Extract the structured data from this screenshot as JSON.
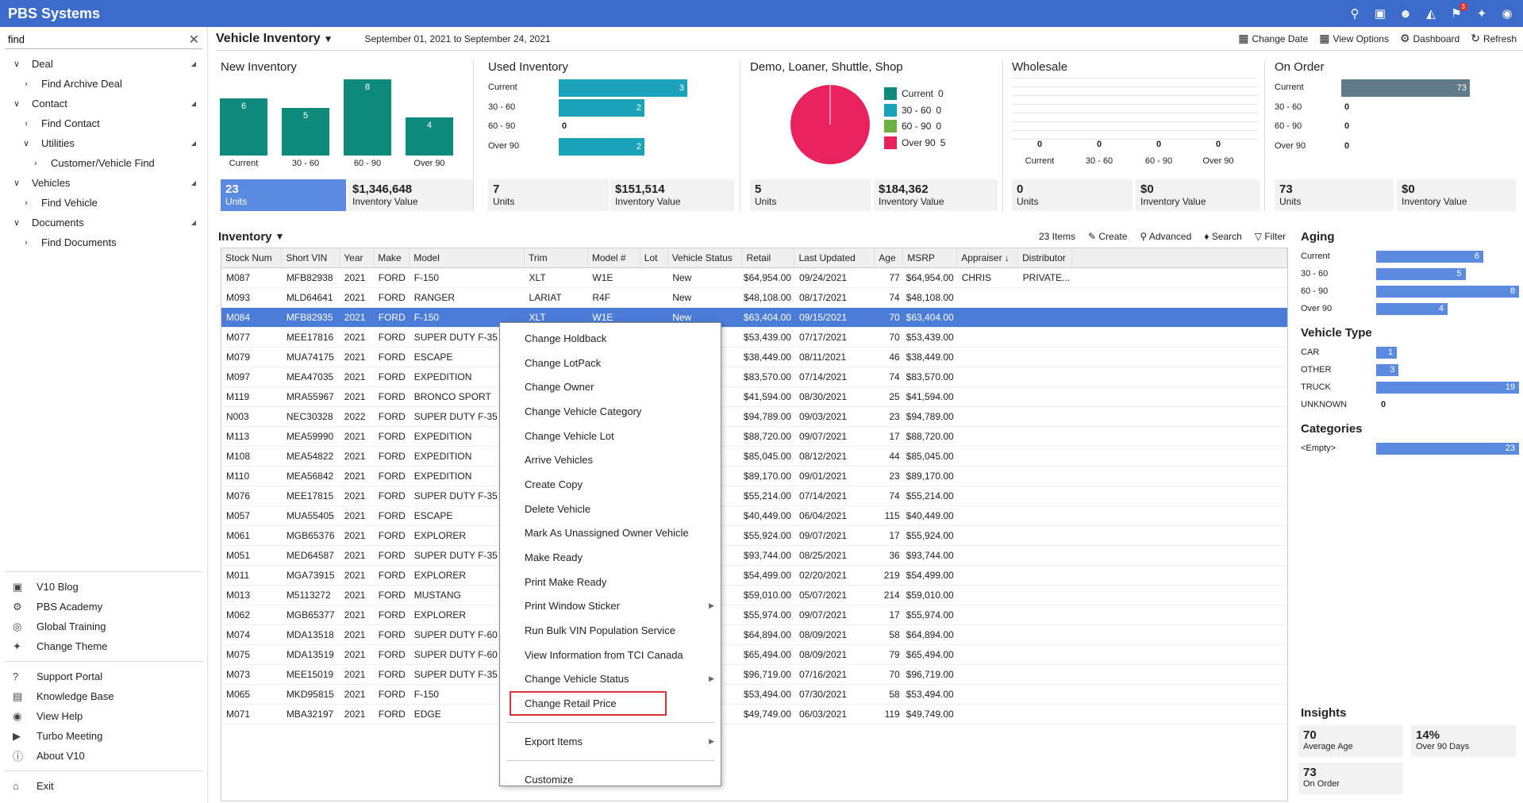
{
  "app": {
    "title": "PBS Systems"
  },
  "topbar": {
    "icons": [
      "search-icon",
      "chat-icon",
      "users-icon",
      "inbox-icon",
      "flag-icon",
      "pin-icon",
      "eye-icon"
    ],
    "flag_badge": "3"
  },
  "sidebar": {
    "search_value": "find",
    "tree": [
      {
        "label": "Deal",
        "level": 0,
        "expanded": true
      },
      {
        "label": "Find Archive Deal",
        "level": 1,
        "expanded": false
      },
      {
        "label": "Contact",
        "level": 0,
        "expanded": true
      },
      {
        "label": "Find Contact",
        "level": 1,
        "expanded": false
      },
      {
        "label": "Utilities",
        "level": 1,
        "expanded": true
      },
      {
        "label": "Customer/Vehicle Find",
        "level": 2,
        "expanded": false
      },
      {
        "label": "Vehicles",
        "level": 0,
        "expanded": true
      },
      {
        "label": "Find Vehicle",
        "level": 1,
        "expanded": false
      },
      {
        "label": "Documents",
        "level": 0,
        "expanded": true
      },
      {
        "label": "Find Documents",
        "level": 1,
        "expanded": false
      }
    ],
    "links_a": [
      {
        "label": "V10 Blog",
        "icon": "blog-icon"
      },
      {
        "label": "PBS Academy",
        "icon": "academy-icon"
      },
      {
        "label": "Global Training",
        "icon": "globe-icon"
      },
      {
        "label": "Change Theme",
        "icon": "theme-icon"
      }
    ],
    "links_b": [
      {
        "label": "Support Portal",
        "icon": "help-icon"
      },
      {
        "label": "Knowledge Base",
        "icon": "book-icon"
      },
      {
        "label": "View Help",
        "icon": "eye-icon"
      },
      {
        "label": "Turbo Meeting",
        "icon": "video-icon"
      },
      {
        "label": "About V10",
        "icon": "info-icon"
      }
    ],
    "exit": "Exit"
  },
  "header": {
    "title": "Vehicle Inventory",
    "date_range": "September 01, 2021 to September 24, 2021",
    "actions": {
      "change_date": "Change Date",
      "view_options": "View Options",
      "dashboard": "Dashboard",
      "refresh": "Refresh"
    }
  },
  "cards": {
    "new": {
      "title": "New Inventory",
      "categories": [
        "Current",
        "30 - 60",
        "60 - 90",
        "Over 90"
      ],
      "values": [
        6,
        5,
        8,
        4
      ],
      "units": "23",
      "units_label": "Units",
      "value": "$1,346,648",
      "value_label": "Inventory Value"
    },
    "used": {
      "title": "Used Inventory",
      "categories": [
        "Current",
        "30 - 60",
        "60 - 90",
        "Over 90"
      ],
      "values": [
        3,
        2,
        0,
        2
      ],
      "units": "7",
      "units_label": "Units",
      "value": "$151,514",
      "value_label": "Inventory Value"
    },
    "demo": {
      "title": "Demo, Loaner, Shuttle, Shop",
      "legend": [
        {
          "label": "Current",
          "value": "0",
          "color": "#0d8a7a"
        },
        {
          "label": "30 - 60",
          "value": "0",
          "color": "#1aa3b8"
        },
        {
          "label": "60 - 90",
          "value": "0",
          "color": "#6fb043"
        },
        {
          "label": "Over 90",
          "value": "5",
          "color": "#e8215f"
        }
      ],
      "units": "5",
      "units_label": "Units",
      "value": "$184,362",
      "value_label": "Inventory Value"
    },
    "wholesale": {
      "title": "Wholesale",
      "categories": [
        "Current",
        "30 - 60",
        "60 - 90",
        "Over 90"
      ],
      "values": [
        "0",
        "0",
        "0",
        "0"
      ],
      "units": "0",
      "units_label": "Units",
      "value": "$0",
      "value_label": "Inventory Value"
    },
    "onorder": {
      "title": "On Order",
      "categories": [
        "Current",
        "30 - 60",
        "60 - 90",
        "Over 90"
      ],
      "values": [
        73,
        0,
        0,
        0
      ],
      "units": "73",
      "units_label": "Units",
      "value": "$0",
      "value_label": "Inventory Value"
    }
  },
  "inventory": {
    "title": "Inventory",
    "item_count": "23 Items",
    "tools": {
      "create": "Create",
      "advanced": "Advanced",
      "search": "Search",
      "filter": "Filter"
    },
    "columns": [
      "Stock Num",
      "Short VIN",
      "Year",
      "Make",
      "Model",
      "Trim",
      "Model #",
      "Lot",
      "Vehicle Status",
      "Retail",
      "Last Updated",
      "Age",
      "MSRP",
      "Appraiser",
      "Distributor"
    ],
    "rows": [
      [
        "M087",
        "MFB82938",
        "2021",
        "FORD",
        "F-150",
        "XLT",
        "W1E",
        "",
        "New",
        "$64,954.00",
        "09/24/2021",
        "77",
        "$64,954.00",
        "CHRIS",
        "PRIVATE..."
      ],
      [
        "M093",
        "MLD64641",
        "2021",
        "FORD",
        "RANGER",
        "LARIAT",
        "R4F",
        "",
        "New",
        "$48,108.00",
        "08/17/2021",
        "74",
        "$48,108.00",
        "",
        ""
      ],
      [
        "M084",
        "MFB82935",
        "2021",
        "FORD",
        "F-150",
        "XLT",
        "W1E",
        "",
        "New",
        "$63,404.00",
        "09/15/2021",
        "70",
        "$63,404.00",
        "",
        ""
      ],
      [
        "M077",
        "MEE17816",
        "2021",
        "FORD",
        "SUPER DUTY F-35",
        "",
        "",
        "",
        "",
        "$53,439.00",
        "07/17/2021",
        "70",
        "$53,439.00",
        "",
        ""
      ],
      [
        "M079",
        "MUA74175",
        "2021",
        "FORD",
        "ESCAPE",
        "",
        "",
        "",
        "",
        "$38,449.00",
        "08/11/2021",
        "46",
        "$38,449.00",
        "",
        ""
      ],
      [
        "M097",
        "MEA47035",
        "2021",
        "FORD",
        "EXPEDITION",
        "",
        "",
        "",
        "",
        "$83,570.00",
        "07/14/2021",
        "74",
        "$83,570.00",
        "",
        ""
      ],
      [
        "M119",
        "MRA55967",
        "2021",
        "FORD",
        "BRONCO SPORT",
        "",
        "",
        "",
        "",
        "$41,594.00",
        "08/30/2021",
        "25",
        "$41,594.00",
        "",
        ""
      ],
      [
        "N003",
        "NEC30328",
        "2022",
        "FORD",
        "SUPER DUTY F-35",
        "",
        "",
        "",
        "",
        "$94,789.00",
        "09/03/2021",
        "23",
        "$94,789.00",
        "",
        ""
      ],
      [
        "M113",
        "MEA59990",
        "2021",
        "FORD",
        "EXPEDITION",
        "",
        "",
        "",
        "",
        "$88,720.00",
        "09/07/2021",
        "17",
        "$88,720.00",
        "",
        ""
      ],
      [
        "M108",
        "MEA54822",
        "2021",
        "FORD",
        "EXPEDITION",
        "",
        "",
        "",
        "",
        "$85,045.00",
        "08/12/2021",
        "44",
        "$85,045.00",
        "",
        ""
      ],
      [
        "M110",
        "MEA56842",
        "2021",
        "FORD",
        "EXPEDITION",
        "",
        "",
        "",
        "",
        "$89,170.00",
        "09/01/2021",
        "23",
        "$89,170.00",
        "",
        ""
      ],
      [
        "M076",
        "MEE17815",
        "2021",
        "FORD",
        "SUPER DUTY F-35",
        "",
        "",
        "",
        "",
        "$55,214.00",
        "07/14/2021",
        "74",
        "$55,214.00",
        "",
        ""
      ],
      [
        "M057",
        "MUA55405",
        "2021",
        "FORD",
        "ESCAPE",
        "",
        "",
        "",
        "",
        "$40,449.00",
        "06/04/2021",
        "115",
        "$40,449.00",
        "",
        ""
      ],
      [
        "M061",
        "MGB65376",
        "2021",
        "FORD",
        "EXPLORER",
        "",
        "",
        "",
        "",
        "$55,924.00",
        "09/07/2021",
        "17",
        "$55,924.00",
        "",
        ""
      ],
      [
        "M051",
        "MED64587",
        "2021",
        "FORD",
        "SUPER DUTY F-35",
        "",
        "",
        "",
        "",
        "$93,744.00",
        "08/25/2021",
        "36",
        "$93,744.00",
        "",
        ""
      ],
      [
        "M011",
        "MGA73915",
        "2021",
        "FORD",
        "EXPLORER",
        "",
        "",
        "",
        "",
        "$54,499.00",
        "02/20/2021",
        "219",
        "$54,499.00",
        "",
        ""
      ],
      [
        "M013",
        "M5113272",
        "2021",
        "FORD",
        "MUSTANG",
        "",
        "",
        "",
        "",
        "$59,010.00",
        "05/07/2021",
        "214",
        "$59,010.00",
        "",
        ""
      ],
      [
        "M062",
        "MGB65377",
        "2021",
        "FORD",
        "EXPLORER",
        "",
        "",
        "",
        "",
        "$55,974.00",
        "09/07/2021",
        "17",
        "$55,974.00",
        "",
        ""
      ],
      [
        "M074",
        "MDA13518",
        "2021",
        "FORD",
        "SUPER DUTY F-60",
        "",
        "",
        "",
        "",
        "$64,894.00",
        "08/09/2021",
        "58",
        "$64,894.00",
        "",
        ""
      ],
      [
        "M075",
        "MDA13519",
        "2021",
        "FORD",
        "SUPER DUTY F-60",
        "",
        "",
        "",
        "",
        "$65,494.00",
        "08/09/2021",
        "79",
        "$65,494.00",
        "",
        ""
      ],
      [
        "M073",
        "MEE15019",
        "2021",
        "FORD",
        "SUPER DUTY F-35",
        "",
        "",
        "",
        "",
        "$96,719.00",
        "07/16/2021",
        "70",
        "$96,719.00",
        "",
        ""
      ],
      [
        "M065",
        "MKD95815",
        "2021",
        "FORD",
        "F-150",
        "",
        "",
        "",
        "",
        "$53,494.00",
        "07/30/2021",
        "58",
        "$53,494.00",
        "",
        ""
      ],
      [
        "M071",
        "MBA32197",
        "2021",
        "FORD",
        "EDGE",
        "",
        "",
        "",
        "",
        "$49,749.00",
        "06/03/2021",
        "119",
        "$49,749.00",
        "",
        ""
      ]
    ],
    "selected_row": 2
  },
  "context_menu": {
    "items": [
      {
        "label": "Change Holdback"
      },
      {
        "label": "Change LotPack"
      },
      {
        "label": "Change Owner"
      },
      {
        "label": "Change Vehicle Category"
      },
      {
        "label": "Change Vehicle Lot"
      },
      {
        "label": "Arrive Vehicles"
      },
      {
        "label": "Create Copy"
      },
      {
        "label": "Delete Vehicle"
      },
      {
        "label": "Mark As Unassigned Owner Vehicle"
      },
      {
        "label": "Make Ready"
      },
      {
        "label": "Print Make Ready"
      },
      {
        "label": "Print Window Sticker",
        "submenu": true
      },
      {
        "label": "Run Bulk VIN Population Service"
      },
      {
        "label": "View Information from TCI Canada"
      },
      {
        "label": "Change Vehicle Status",
        "submenu": true
      },
      {
        "label": "Change Retail Price",
        "highlighted": true
      }
    ],
    "export": "Export Items",
    "customize": "Customize"
  },
  "right_panel": {
    "aging": {
      "title": "Aging",
      "rows": [
        {
          "label": "Current",
          "value": 6
        },
        {
          "label": "30 - 60",
          "value": 5
        },
        {
          "label": "60 - 90",
          "value": 8
        },
        {
          "label": "Over 90",
          "value": 4
        }
      ],
      "max": 8
    },
    "vehicle_type": {
      "title": "Vehicle Type",
      "rows": [
        {
          "label": "CAR",
          "value": 1
        },
        {
          "label": "OTHER",
          "value": 3
        },
        {
          "label": "TRUCK",
          "value": 19
        },
        {
          "label": "UNKNOWN",
          "value": 0
        }
      ],
      "max": 19
    },
    "categories": {
      "title": "Categories",
      "rows": [
        {
          "label": "<Empty>",
          "value": 23
        }
      ],
      "max": 23
    },
    "insights": {
      "title": "Insights",
      "avg_age": "70",
      "avg_age_label": "Average Age",
      "over90": "14%",
      "over90_label": "Over 90 Days",
      "on_order": "73",
      "on_order_label": "On Order"
    }
  }
}
